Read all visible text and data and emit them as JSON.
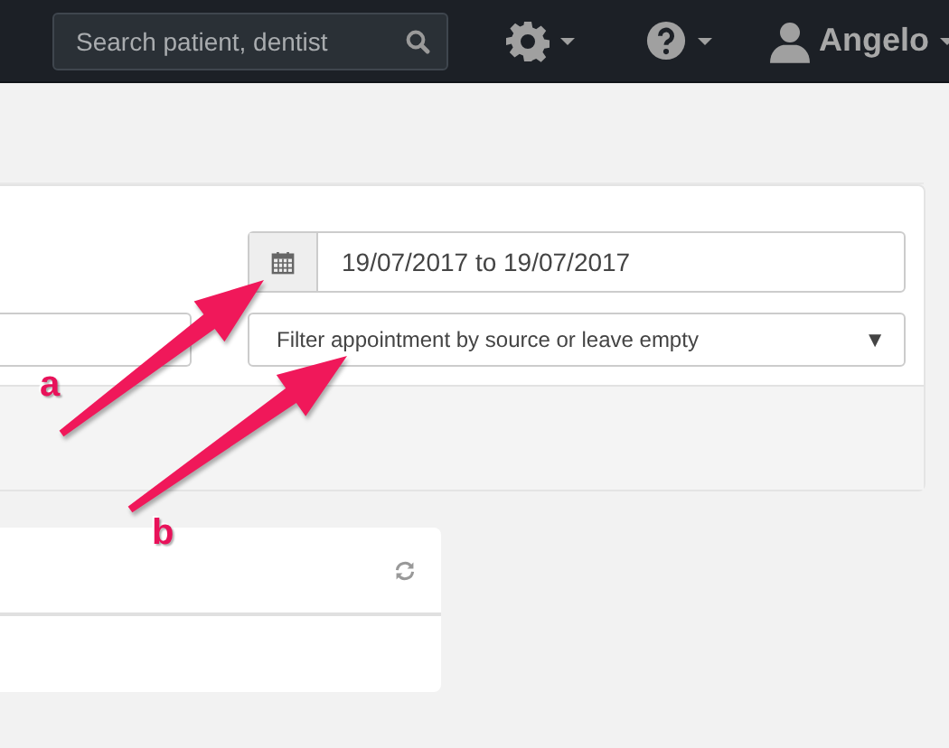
{
  "navbar": {
    "search": {
      "placeholder": "Search patient, dentist"
    },
    "user": {
      "name": "Angelo"
    }
  },
  "filters": {
    "date_range": "19/07/2017 to 19/07/2017",
    "source_select": {
      "placeholder": "Filter appointment by source or leave empty",
      "arrow": "▼"
    }
  },
  "annotations": [
    {
      "label": "a"
    },
    {
      "label": "b"
    }
  ]
}
